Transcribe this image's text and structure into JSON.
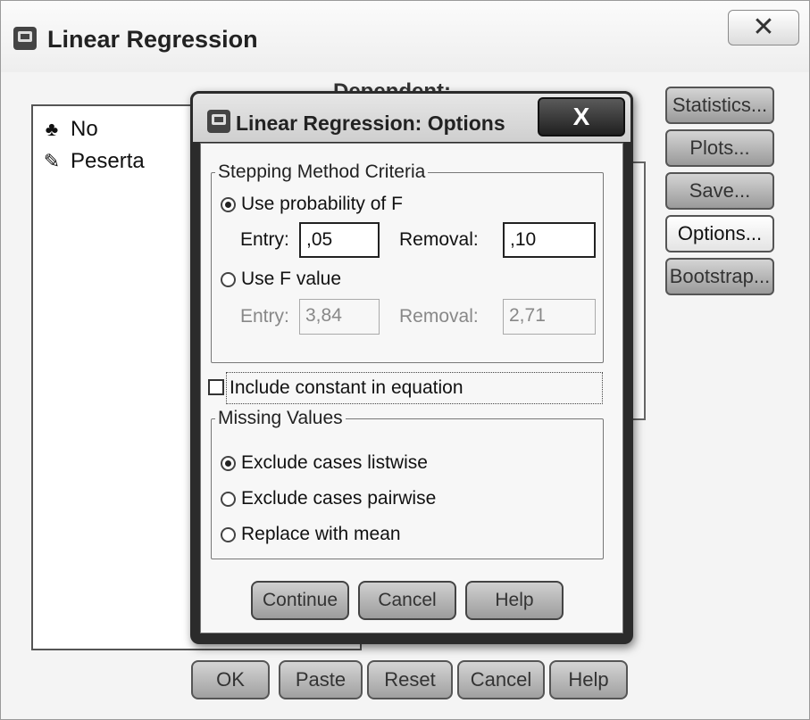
{
  "main_window": {
    "title": "Linear Regression",
    "close_glyph": "✕",
    "dependent_label": "Dependent:",
    "variables": [
      {
        "name": "No",
        "icon": "scale-nominal-icon"
      },
      {
        "name": "Peserta",
        "icon": "scale-string-icon"
      }
    ],
    "side_buttons": [
      "Statistics...",
      "Plots...",
      "Save...",
      "Options...",
      "Bootstrap..."
    ],
    "bottom_buttons": [
      "OK",
      "Paste",
      "Reset",
      "Cancel",
      "Help"
    ]
  },
  "dialog": {
    "title": "Linear Regression: Options",
    "close_glyph": "X",
    "stepping": {
      "legend": "Stepping Method Criteria",
      "use_probability_label": "Use probability of F",
      "probability_entry_label": "Entry:",
      "probability_entry_value": ",05",
      "probability_removal_label": "Removal:",
      "probability_removal_value": ",10",
      "use_f_value_label": "Use F value",
      "f_entry_label": "Entry:",
      "f_entry_value": "3,84",
      "f_removal_label": "Removal:",
      "f_removal_value": "2,71",
      "selected": "probability"
    },
    "include_constant_label": "Include constant in equation",
    "include_constant_checked": false,
    "missing": {
      "legend": "Missing Values",
      "options": [
        "Exclude cases listwise",
        "Exclude cases pairwise",
        "Replace with mean"
      ],
      "selected": 0
    },
    "buttons": [
      "Continue",
      "Cancel",
      "Help"
    ]
  }
}
